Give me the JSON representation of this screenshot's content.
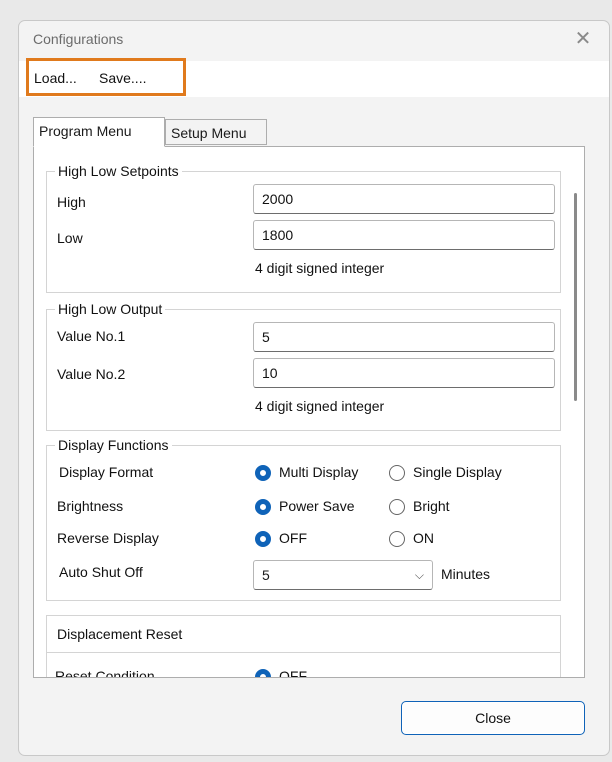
{
  "window": {
    "title": "Configurations",
    "close_glyph": "✕"
  },
  "menu": {
    "load": "Load...",
    "save": "Save...."
  },
  "tabs": [
    "Program Menu",
    "Setup Menu"
  ],
  "high_low_setpoints": {
    "title": "High Low Setpoints",
    "high_label": "High",
    "high_value": "2000",
    "low_label": "Low",
    "low_value": "1800",
    "hint": "4 digit signed integer"
  },
  "high_low_output": {
    "title": "High Low Output",
    "v1_label": "Value No.1",
    "v1_value": "5",
    "v2_label": "Value No.2",
    "v2_value": "10",
    "hint": "4 digit signed integer"
  },
  "display_functions": {
    "title": "Display Functions",
    "format_label": "Display Format",
    "format_opt1": "Multi Display",
    "format_opt2": "Single Display",
    "brightness_label": "Brightness",
    "brightness_opt1": "Power Save",
    "brightness_opt2": "Bright",
    "reverse_label": "Reverse Display",
    "reverse_opt1": "OFF",
    "reverse_opt2": "ON",
    "autoshut_label": "Auto Shut Off",
    "autoshut_value": "5",
    "autoshut_unit": "Minutes"
  },
  "displacement_reset": {
    "title": "Displacement Reset",
    "reset_label": "Reset Condition",
    "reset_opt1": "OFF"
  },
  "buttons": {
    "close": "Close"
  },
  "colors": {
    "accent": "#0f63b8",
    "highlight": "#e07a1d"
  }
}
